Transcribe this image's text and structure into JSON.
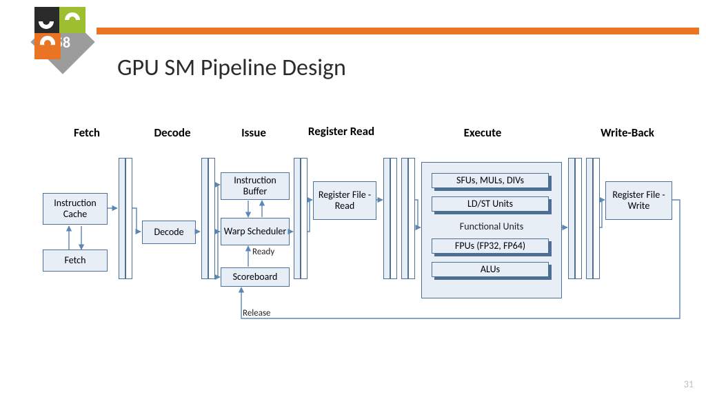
{
  "title": "GPU SM Pipeline Design",
  "page_number": "31",
  "stages": {
    "fetch": {
      "label": "Fetch"
    },
    "decode": {
      "label": "Decode"
    },
    "issue": {
      "label": "Issue"
    },
    "regread": {
      "label": "Register Read"
    },
    "execute": {
      "label": "Execute"
    },
    "wb": {
      "label": "Write-Back"
    }
  },
  "boxes": {
    "icache": "Instruction Cache",
    "fetch": "Fetch",
    "decode": "Decode",
    "ibuf": "Instruction Buffer",
    "warpsched": "Warp Scheduler",
    "scoreboard": "Scoreboard",
    "rfread": "Register File - Read",
    "functional": "Functional Units",
    "sfu": "SFUs, MULs, DIVs",
    "ldst": "LD/ST Units",
    "fpu": "FPUs (FP32, FP64)",
    "alu": "ALUs",
    "rfwrite": "Register File - Write"
  },
  "labels": {
    "ready": "Ready",
    "release": "Release"
  },
  "colors": {
    "accent_orange": "#E87424",
    "box_fill": "#E7EEF6",
    "box_border": "#4d6f94",
    "arrow": "#5b87b5"
  }
}
